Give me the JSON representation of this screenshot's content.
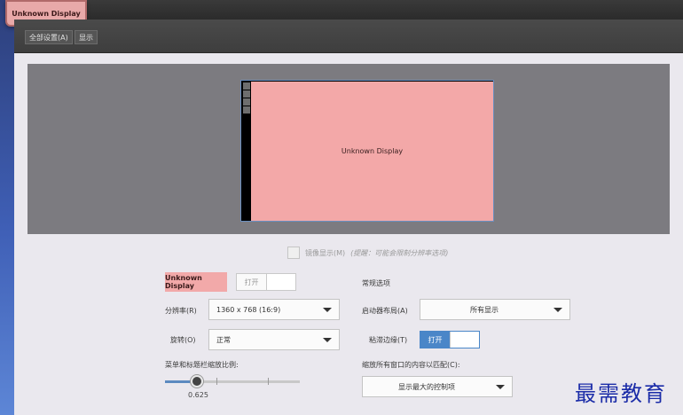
{
  "window": {
    "title": "Unknown Display"
  },
  "toolbar": {
    "items": [
      "全部设置(A)",
      "显示"
    ]
  },
  "preview": {
    "display_label": "Unknown Display"
  },
  "mirror": {
    "label": "镜像显示(M)",
    "hint": "(提醒：可能会限制分辨率选项)"
  },
  "display": {
    "name": "Unknown Display",
    "power_toggle": {
      "label": "打开",
      "state": "off"
    },
    "resolution": {
      "label": "分辨率(R)",
      "value": "1360 x 768 (16:9)"
    },
    "rotation": {
      "label": "旋转(O)",
      "value": "正常"
    },
    "scale": {
      "label": "菜单和标题栏缩放比例:",
      "value": "0.625",
      "fraction": 0.24
    }
  },
  "general": {
    "title": "常规选项",
    "launcher": {
      "label": "启动器布局(A)",
      "value": "所有显示"
    },
    "sticky_edges": {
      "label": "粘滞边缘(T)",
      "toggle_label": "打开",
      "state": "on"
    },
    "fit_windows": {
      "label": "缩放所有窗口的内容以匹配(C):",
      "value": "显示最大的控制项"
    }
  },
  "watermark": {
    "text": "最需教育"
  },
  "colors": {
    "accent": "#4a86c8",
    "display_pink": "#f3a8a8"
  }
}
